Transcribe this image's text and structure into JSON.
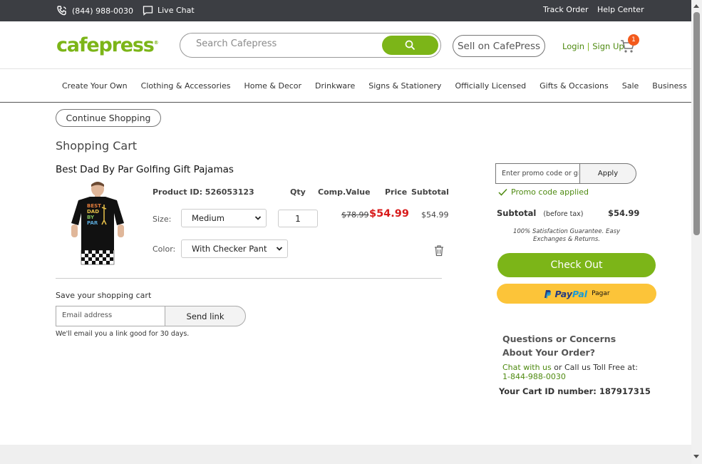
{
  "topbar": {
    "phone": "(844) 988-0030",
    "live_chat": "Live Chat",
    "track_order": "Track Order",
    "help_center": "Help Center"
  },
  "header": {
    "logo": "cafepress",
    "search_placeholder": "Search Cafepress",
    "sell_label": "Sell on CafePress",
    "login_label": "Login",
    "signup_label": "Sign Up",
    "cart_count": "1"
  },
  "nav": {
    "items": [
      "Create Your Own",
      "Clothing & Accessories",
      "Home & Decor",
      "Drinkware",
      "Signs & Stationery",
      "Officially Licensed",
      "Gifts & Occasions",
      "Sale",
      "Business"
    ]
  },
  "cart": {
    "continue_label": "Continue Shopping",
    "title": "Shopping Cart",
    "product": {
      "name": "Best Dad By Par Golfing Gift Pajamas",
      "image_text": [
        "BEST",
        "DAD",
        "BY",
        "PAR"
      ],
      "id_label": "Product ID: 526053123",
      "size_label": "Size:",
      "size_value": "Medium",
      "color_label": "Color:",
      "color_value": "With Checker Pant",
      "qty": "1",
      "old_price": "$78.99",
      "price": "$54.99",
      "subtotal": "$54.99"
    },
    "columns": {
      "qty": "Qty",
      "comp_value": "Comp.Value",
      "price": "Price",
      "subtotal": "Subtotal"
    },
    "save": {
      "label": "Save your shopping cart",
      "email_placeholder": "Email address",
      "send_label": "Send link",
      "note": "We'll email you a link good for 30 days."
    }
  },
  "summary": {
    "promo_placeholder": "Enter promo code or gift card",
    "apply_label": "Apply",
    "promo_status": "Promo code applied",
    "subtotal_label": "Subtotal",
    "subtotal_note": "(before tax)",
    "subtotal_value": "$54.99",
    "guarantee": "100% Satisfaction Guarantee. Easy Exchanges & Returns.",
    "checkout_label": "Check Out",
    "paypal_pay": "Pay",
    "paypal_pal": "Pal",
    "paypal_label": "Pagar",
    "questions": "Questions or Concerns About Your Order?",
    "chat_link": "Chat with us",
    "call_text": " or Call us Toll Free at:",
    "phone": "1-844-988-0030",
    "cart_id": "Your Cart ID number: 187917315"
  },
  "colors": {
    "brand_green": "#7cb518",
    "price_red": "#d81b1b",
    "badge_orange": "#f35a1c",
    "paypal_yellow": "#fcc439",
    "topbar": "#3c3e43"
  }
}
